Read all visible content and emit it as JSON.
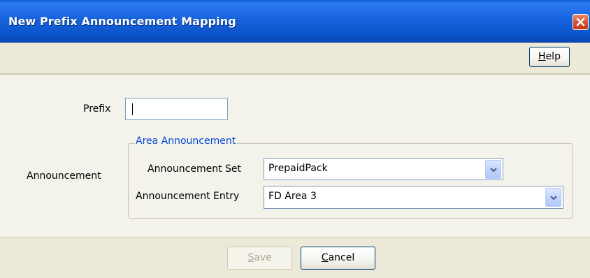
{
  "window": {
    "title": "New Prefix Announcement Mapping"
  },
  "toolbar": {
    "help_label": "Help",
    "help_mnemonic": "H",
    "help_rest": "elp"
  },
  "form": {
    "prefix_label": "Prefix",
    "prefix_value": "",
    "announcement_label": "Announcement",
    "group_legend": "Area Announcement",
    "announcement_set_label": "Announcement Set",
    "announcement_set_value": "PrepaidPack",
    "announcement_entry_label": "Announcement Entry",
    "announcement_entry_value": "FD Area 3"
  },
  "footer": {
    "save_label": "Save",
    "save_mnemonic": "S",
    "save_rest": "ave",
    "save_enabled": false,
    "cancel_label": "Cancel",
    "cancel_mnemonic": "C",
    "cancel_rest": "ancel"
  },
  "colors": {
    "titlebar": "#0a52c8",
    "legend": "#0046d5",
    "close": "#d7522c"
  },
  "icons": {
    "close": "close-icon",
    "dropdown": "chevron-down-icon"
  }
}
